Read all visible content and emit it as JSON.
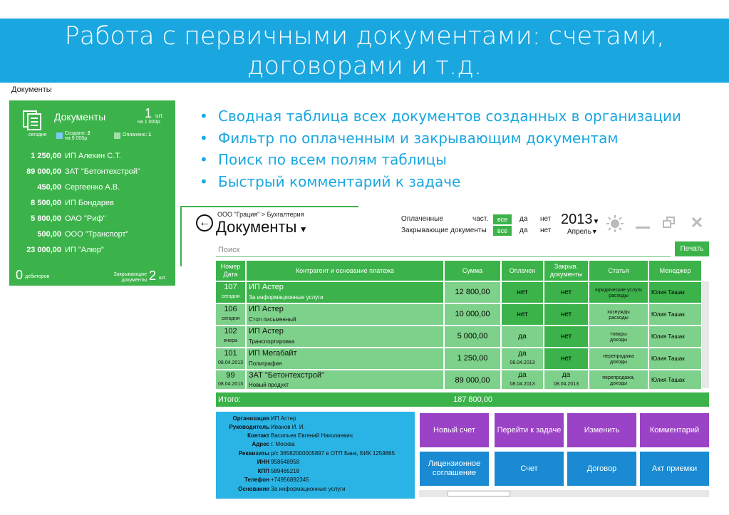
{
  "slide": {
    "title_line1": "Работа с первичными документами: счетами,",
    "title_line2": "договорами и т.д.",
    "bullets": [
      "Сводная таблица всех документов созданных в организации",
      "Фильтр по оплаченным и закрывающим документам",
      "Поиск по всем полям таблицы",
      "Быстрый комментарий к задаче"
    ]
  },
  "tile": {
    "caption": "Документы",
    "title": "Документы",
    "today": "сегодня",
    "count": "1",
    "count_unit": "шт.",
    "count_sub": "на 1 000р.",
    "created_label": "Создано:",
    "created_value": "2",
    "created_sub": "на 9 000р.",
    "paid_label": "Оплачено:",
    "paid_value": "1",
    "rows": [
      {
        "amount": "1 250,00",
        "name": "ИП Алехин С.Т."
      },
      {
        "amount": "89 000,00",
        "name": "ЗАТ \"Бетонтехстрой\""
      },
      {
        "amount": "450,00",
        "name": "Сергеенко А.В."
      },
      {
        "amount": "8 500,00",
        "name": "ИП Бондарев"
      },
      {
        "amount": "5 800,00",
        "name": "ОАО \"Риф\""
      },
      {
        "amount": "500,00",
        "name": "ООО \"Транспорт\""
      },
      {
        "amount": "23 000,00",
        "name": "ИП \"Алюр\""
      }
    ],
    "debtors_value": "0",
    "debtors_label": "дебиторов",
    "closing_label_1": "Закрывающие",
    "closing_label_2": "документы",
    "closing_value": "2",
    "closing_unit": "шт."
  },
  "app": {
    "breadcrumb": "ООО \"Грация\" > Бухгалтерия",
    "title": "Документы",
    "filters": {
      "paid_label": "Оплаченные",
      "closing_label": "Закрывающие документы",
      "partial": "част.",
      "all": "все",
      "yes": "да",
      "no": "нет"
    },
    "year": "2013",
    "month": "Апрель",
    "search_placeholder": "Поиск",
    "print_label": "Печать",
    "columns": [
      "Номер Дата",
      "Контрагент и основание платежа",
      "Сумма",
      "Оплачен",
      "Закрыв. документы",
      "Статья",
      "Менеджер"
    ],
    "rows": [
      {
        "num": "107",
        "date": "сегодня",
        "party": "ИП Астер",
        "basis": "За информационные услуги",
        "sum": "12 800,00",
        "paid": "нет",
        "paid_date": "",
        "closed": "нет",
        "closed_date": "",
        "article_1": "юридические услуги",
        "article_2": "расходы",
        "manager": "Юлия Ташак"
      },
      {
        "num": "106",
        "date": "сегодня",
        "party": "ИП Астер",
        "basis": "Стол письменный",
        "sum": "10 000,00",
        "paid": "нет",
        "paid_date": "",
        "closed": "нет",
        "closed_date": "",
        "article_1": "хознужды",
        "article_2": "расходы",
        "manager": "Юлия Ташак"
      },
      {
        "num": "102",
        "date": "вчера",
        "party": "ИП Астер",
        "basis": "Транспортировка",
        "sum": "5 000,00",
        "paid": "да",
        "paid_date": "",
        "closed": "нет",
        "closed_date": "",
        "article_1": "товары",
        "article_2": "доходы",
        "manager": "Юлия Ташак"
      },
      {
        "num": "101",
        "date": "08.04.2013",
        "party": "ИП Мегабайт",
        "basis": "Полиграфия",
        "sum": "1 250,00",
        "paid": "да",
        "paid_date": "08.04.2013",
        "closed": "нет",
        "closed_date": "",
        "article_1": "перепродажа",
        "article_2": "доходы",
        "manager": "Юлия Ташак"
      },
      {
        "num": "99",
        "date": "08.04.2013",
        "party": "ЗАТ \"Бетонтехстрой\"",
        "basis": "Новый продукт",
        "sum": "89 000,00",
        "paid": "да",
        "paid_date": "08.04.2013",
        "closed": "да",
        "closed_date": "08.04.2013",
        "article_1": "перепродажа,",
        "article_2": "доходы",
        "manager": "Юлия Ташак"
      }
    ],
    "total_label": "Итого:",
    "total_value": "187 800,00",
    "details": [
      {
        "label": "Организация",
        "value": "ИП Астер"
      },
      {
        "label": "Руководитель",
        "value": "Иванов И. И."
      },
      {
        "label": "Контакт",
        "value": "Васильев Евгений Николаевич"
      },
      {
        "label": "Адрес",
        "value": "г. Москва"
      },
      {
        "label": "Реквизиты",
        "value": "р/с 36582000005897 в ОТП Банк, БИК 1259865"
      },
      {
        "label": "ИНН",
        "value": "958648958"
      },
      {
        "label": "КПП",
        "value": "589465218"
      },
      {
        "label": "Телефон",
        "value": "+74956892345"
      },
      {
        "label": "Основание",
        "value": "За информационные услуги"
      }
    ],
    "actions": {
      "new_invoice": "Новый счет",
      "go_task": "Перейти к задаче",
      "edit": "Изменить",
      "comment": "Комментарий",
      "license": "Лицензионное соглашение",
      "invoice": "Счет",
      "contract": "Договор",
      "act": "Акт приемки"
    }
  },
  "colors": {
    "header": "#1aa7e0",
    "green": "#3cb34a",
    "light_green": "#7ed18a",
    "purple": "#9b43c6",
    "blue": "#1a8ad2",
    "details": "#2ab4e6"
  }
}
